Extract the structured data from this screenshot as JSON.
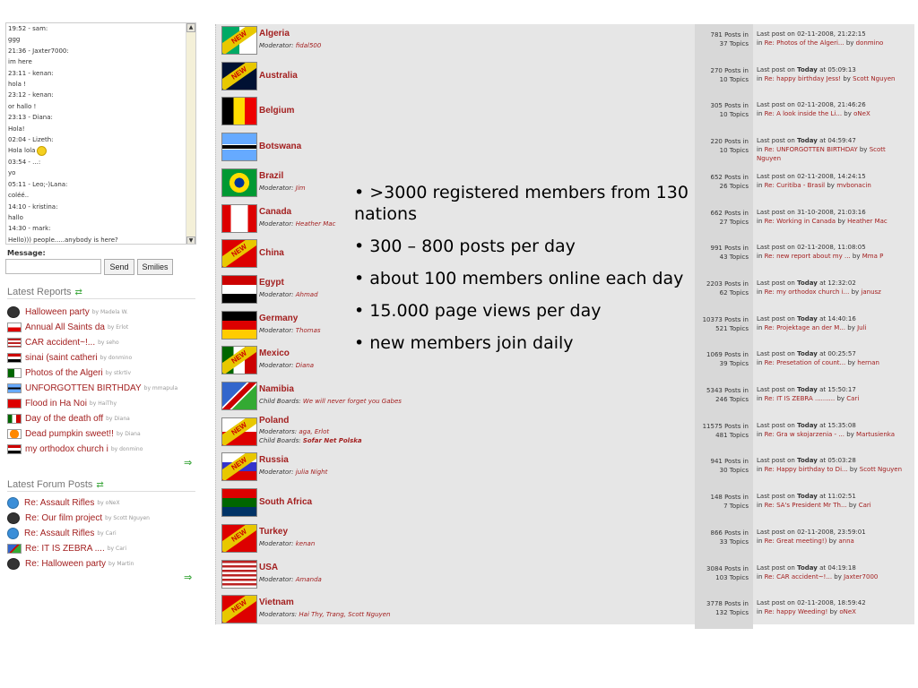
{
  "chat": {
    "lines": [
      "19:52 - sam:",
      "ggg",
      "21:36 - Jaxter7000:",
      "im here",
      "23:11 - kenan:",
      "hola !",
      "23:12 - kenan:",
      "or hallo !",
      "23:13 - Diana:",
      "Hola!",
      "02:04 - Lizeth:",
      "Hola lola",
      "03:54 - ...:",
      "yo",
      "05:11 - Leo;-)Lana:",
      "coléé..",
      "14:10 - kristina:",
      "hallo",
      "14:30 - mark:",
      "Hello))) people.....anybody is here?"
    ],
    "message_label": "Message:",
    "message_value": "",
    "send_label": "Send",
    "smilies_label": "Smilies"
  },
  "latest_reports": {
    "title": "Latest Reports",
    "items": [
      {
        "title": "Halloween party",
        "by": "by Madela W.",
        "icon": "avatar-face-icon"
      },
      {
        "title": "Annual All Saints da",
        "by": "by Erlot",
        "icon": "flag-poland-icon"
      },
      {
        "title": "CAR accident~!...",
        "by": "by seho",
        "icon": "flag-usa-icon"
      },
      {
        "title": "sinai (saint catheri",
        "by": "by donmino",
        "icon": "flag-egypt-icon"
      },
      {
        "title": "Photos of the Algeri",
        "by": "by stkrtiv",
        "icon": "flag-algeria-icon"
      },
      {
        "title": "UNFORGOTTEN BIRTHDAY",
        "by": "by mmapula",
        "icon": "flag-botswana-icon"
      },
      {
        "title": "Flood in Ha Noi",
        "by": "by HaiThy",
        "icon": "flag-vietnam-icon"
      },
      {
        "title": "Day of the death off",
        "by": "by Diana",
        "icon": "flag-mexico-icon"
      },
      {
        "title": "Dead pumpkin sweet!!",
        "by": "by Diana",
        "icon": "pumpkin-icon"
      },
      {
        "title": "my orthodox church i",
        "by": "by donmino",
        "icon": "flag-egypt-icon"
      }
    ]
  },
  "latest_posts": {
    "title": "Latest Forum Posts",
    "items": [
      {
        "title": "Re: Assault Rifles",
        "by": "by oNeX",
        "icon": "globe-icon"
      },
      {
        "title": "Re: Our film project",
        "by": "by Scott Nguyen",
        "icon": "avatar-face-icon"
      },
      {
        "title": "Re: Assault Rifles",
        "by": "by Cari",
        "icon": "globe-icon"
      },
      {
        "title": "Re: IT IS ZEBRA ....",
        "by": "by Cari",
        "icon": "flag-namibia-icon"
      },
      {
        "title": "Re: Halloween party",
        "by": "by Martin",
        "icon": "avatar-face-icon"
      }
    ]
  },
  "boards": [
    {
      "name": "Algeria",
      "mod_label": "Moderator:",
      "mods": "fidal500",
      "is_new": true,
      "posts": "781 Posts in",
      "topics": "37 Topics",
      "last_date_pre": "Last post on 02-11-2008, 21:22:15",
      "last_today": "",
      "last_date_post": "",
      "last_in": "in",
      "last_link": "Re: Photos of the Algeri...",
      "last_by": "by",
      "last_user": "donmino"
    },
    {
      "name": "Australia",
      "mod_label": "",
      "mods": "",
      "is_new": true,
      "posts": "270 Posts in",
      "topics": "10 Topics",
      "last_date_pre": "Last post on ",
      "last_today": "Today",
      "last_date_post": " at 05:09:13",
      "last_in": "in",
      "last_link": "Re: happy birthday Jess!",
      "last_by": "by",
      "last_user": "Scott Nguyen"
    },
    {
      "name": "Belgium",
      "mod_label": "",
      "mods": "",
      "is_new": false,
      "posts": "305 Posts in",
      "topics": "10 Topics",
      "last_date_pre": "Last post on 02-11-2008, 21:46:26",
      "last_today": "",
      "last_date_post": "",
      "last_in": "in",
      "last_link": "Re: A look inside the Li...",
      "last_by": "by",
      "last_user": "oNeX"
    },
    {
      "name": "Botswana",
      "mod_label": "",
      "mods": "",
      "is_new": false,
      "posts": "220 Posts in",
      "topics": "10 Topics",
      "last_date_pre": "Last post on ",
      "last_today": "Today",
      "last_date_post": " at 04:59:47",
      "last_in": "in",
      "last_link": "Re: UNFORGOTTEN BIRTHDAY",
      "last_by": "by",
      "last_user": "Scott Nguyen"
    },
    {
      "name": "Brazil",
      "mod_label": "Moderator:",
      "mods": "Jim",
      "is_new": false,
      "posts": "652 Posts in",
      "topics": "26 Topics",
      "last_date_pre": "Last post on 02-11-2008, 14:24:15",
      "last_today": "",
      "last_date_post": "",
      "last_in": "in",
      "last_link": "Re: Curitiba - Brasil",
      "last_by": "by",
      "last_user": "mvbonacin"
    },
    {
      "name": "Canada",
      "mod_label": "Moderator:",
      "mods": "Heather Mac",
      "is_new": false,
      "posts": "662 Posts in",
      "topics": "27 Topics",
      "last_date_pre": "Last post on 31-10-2008, 21:03:16",
      "last_today": "",
      "last_date_post": "",
      "last_in": "in",
      "last_link": "Re: Working in Canada",
      "last_by": "by",
      "last_user": "Heather Mac"
    },
    {
      "name": "China",
      "mod_label": "",
      "mods": "",
      "is_new": true,
      "posts": "991 Posts in",
      "topics": "43 Topics",
      "last_date_pre": "Last post on 02-11-2008, 11:08:05",
      "last_today": "",
      "last_date_post": "",
      "last_in": "in",
      "last_link": "Re: new report about my ...",
      "last_by": "by",
      "last_user": "Mma P"
    },
    {
      "name": "Egypt",
      "mod_label": "Moderator:",
      "mods": "Ahmad",
      "is_new": false,
      "posts": "2203 Posts in",
      "topics": "62 Topics",
      "last_date_pre": "Last post on ",
      "last_today": "Today",
      "last_date_post": " at 12:32:02",
      "last_in": "in",
      "last_link": "Re: my orthodox church i...",
      "last_by": "by",
      "last_user": "janusz"
    },
    {
      "name": "Germany",
      "mod_label": "Moderator:",
      "mods": "Thomas",
      "is_new": false,
      "posts": "10373 Posts in",
      "topics": "521 Topics",
      "last_date_pre": "Last post on ",
      "last_today": "Today",
      "last_date_post": " at 14:40:16",
      "last_in": "in",
      "last_link": "Re: Projektage an der M...",
      "last_by": "by",
      "last_user": "Juli"
    },
    {
      "name": "Mexico",
      "mod_label": "Moderator:",
      "mods": "Diana",
      "is_new": true,
      "posts": "1069 Posts in",
      "topics": "39 Topics",
      "last_date_pre": "Last post on ",
      "last_today": "Today",
      "last_date_post": " at 00:25:57",
      "last_in": "in",
      "last_link": "Re: Presetation of count...",
      "last_by": "by",
      "last_user": "hernan"
    },
    {
      "name": "Namibia",
      "mod_label": "Child Boards:",
      "mods": "We will never forget you Gabes",
      "is_new": false,
      "posts": "5343 Posts in",
      "topics": "246 Topics",
      "last_date_pre": "Last post on ",
      "last_today": "Today",
      "last_date_post": " at 15:50:17",
      "last_in": "in",
      "last_link": "Re: IT IS ZEBRA ..........",
      "last_by": "by",
      "last_user": "Cari"
    },
    {
      "name": "Poland",
      "mod_label": "Moderators:",
      "mods": "aga, Erlot",
      "mod2_label": "Child Boards:",
      "mods2": "Sofar Net Polska",
      "is_new": true,
      "posts": "11575 Posts in",
      "topics": "481 Topics",
      "last_date_pre": "Last post on ",
      "last_today": "Today",
      "last_date_post": " at 15:35:08",
      "last_in": "in",
      "last_link": "Re: Gra w skojarzenia - ...",
      "last_by": "by",
      "last_user": "Martusienka"
    },
    {
      "name": "Russia",
      "mod_label": "Moderator:",
      "mods": "julia Night",
      "is_new": true,
      "posts": "941 Posts in",
      "topics": "30 Topics",
      "last_date_pre": "Last post on ",
      "last_today": "Today",
      "last_date_post": " at 05:03:28",
      "last_in": "in",
      "last_link": "Re: Happy birthday to Di...",
      "last_by": "by",
      "last_user": "Scott Nguyen"
    },
    {
      "name": "South Africa",
      "mod_label": "",
      "mods": "",
      "is_new": false,
      "posts": "148 Posts in",
      "topics": "7 Topics",
      "last_date_pre": "Last post on ",
      "last_today": "Today",
      "last_date_post": " at 11:02:51",
      "last_in": "in",
      "last_link": "Re: SA's President Mr Th...",
      "last_by": "by",
      "last_user": "Cari"
    },
    {
      "name": "Turkey",
      "mod_label": "Moderator:",
      "mods": "kenan",
      "is_new": true,
      "posts": "866 Posts in",
      "topics": "33 Topics",
      "last_date_pre": "Last post on 02-11-2008, 23:59:01",
      "last_today": "",
      "last_date_post": "",
      "last_in": "in",
      "last_link": "Re: Great meeting!)",
      "last_by": "by",
      "last_user": "anna"
    },
    {
      "name": "USA",
      "mod_label": "Moderator:",
      "mods": "Amanda",
      "is_new": false,
      "posts": "3084 Posts in",
      "topics": "103 Topics",
      "last_date_pre": "Last post on ",
      "last_today": "Today",
      "last_date_post": " at 04:19:18",
      "last_in": "in",
      "last_link": "Re: CAR accident~!...",
      "last_by": "by",
      "last_user": "Jaxter7000"
    },
    {
      "name": "Vietnam",
      "mod_label": "Moderators:",
      "mods": "Hai Thy, Trang, Scott Nguyen",
      "is_new": true,
      "posts": "3778 Posts in",
      "topics": "132 Topics",
      "last_date_pre": "Last post on 02-11-2008, 18:59:42",
      "last_today": "",
      "last_date_post": "",
      "last_in": "in",
      "last_link": "Re: happy Weeding!",
      "last_by": "by",
      "last_user": "oNeX"
    }
  ],
  "new_badge": "NEW",
  "bullets": [
    "• >3000 registered members from 130 nations",
    "• 300 – 800 posts per day",
    "• about 100 members online each day",
    "• 15.000 page views per day",
    "• new members join daily"
  ],
  "colors": {
    "link": "#a32020",
    "board_bg": "#e6e6e6",
    "stats_bg": "#d8d8d8"
  }
}
